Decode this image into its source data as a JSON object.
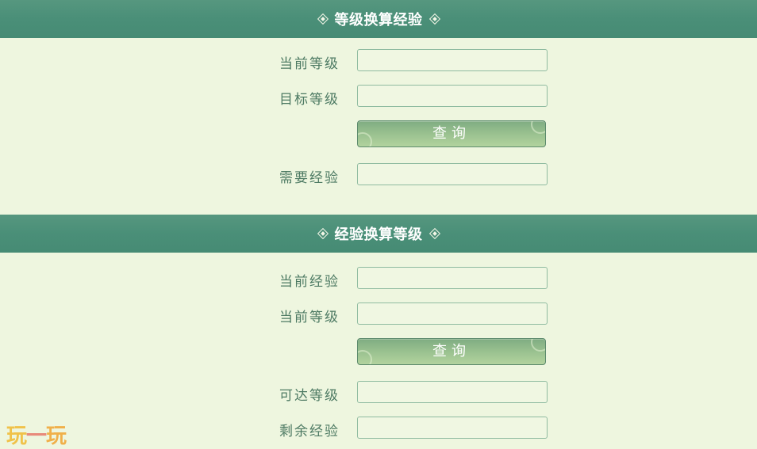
{
  "level_to_exp": {
    "title": "等级换算经验",
    "current_level_label": "当前等级",
    "current_level_value": "",
    "target_level_label": "目标等级",
    "target_level_value": "",
    "query_label": "查询",
    "required_exp_label": "需要经验",
    "required_exp_value": ""
  },
  "exp_to_level": {
    "title": "经验换算等级",
    "current_exp_label": "当前经验",
    "current_exp_value": "",
    "current_level_label": "当前等级",
    "current_level_value": "",
    "query_label": "查询",
    "reachable_level_label": "可达等级",
    "reachable_level_value": "",
    "remaining_exp_label": "剩余经验",
    "remaining_exp_value": ""
  },
  "watermark": {
    "char1": "玩",
    "char2": "一",
    "char3": "玩"
  },
  "colors": {
    "header_bg": "#4a8f78",
    "page_bg": "#eef6df",
    "label_text": "#4d7a63",
    "field_border": "#8fbba0",
    "button_top": "#7fac82",
    "button_bottom": "#b2d39e"
  },
  "icons": {
    "header_ornament": "diamond-icon"
  }
}
